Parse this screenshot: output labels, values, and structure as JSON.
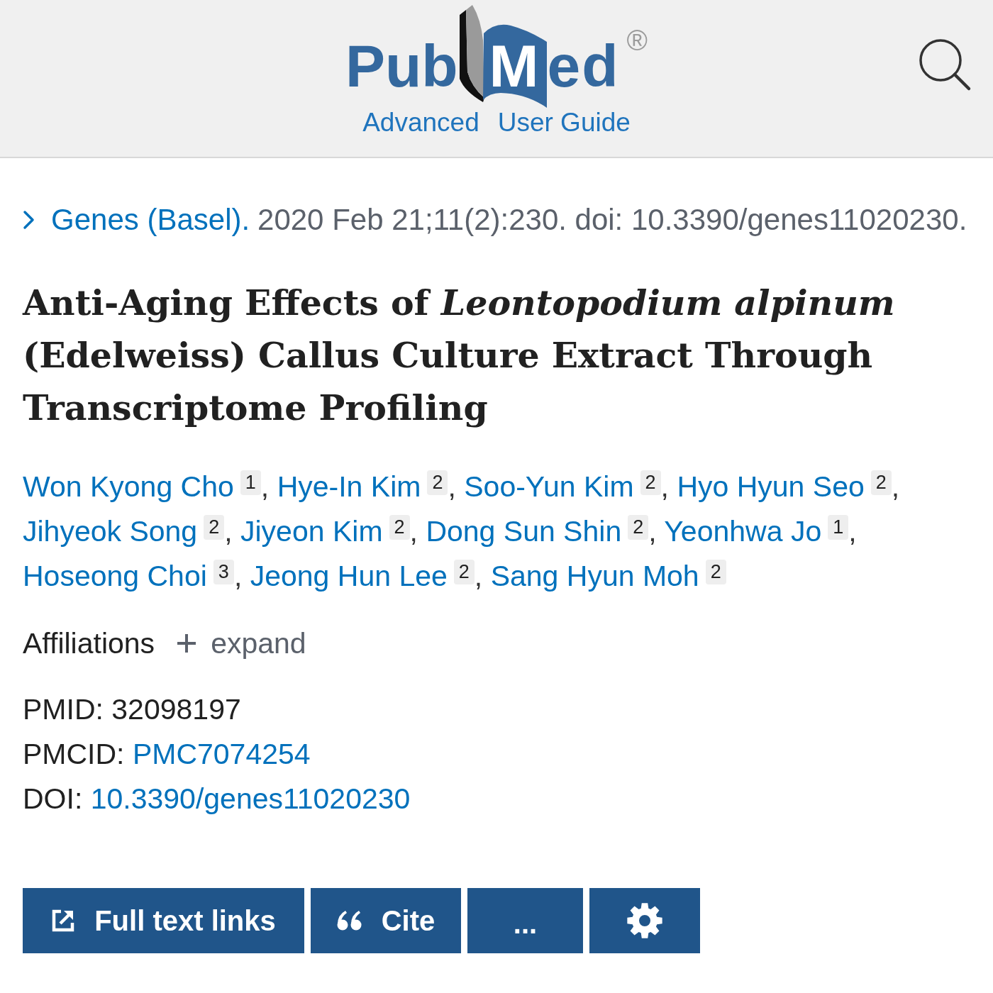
{
  "header": {
    "logo": {
      "left": "Pub",
      "right": "Med",
      "mark": "®"
    },
    "links": [
      "Advanced",
      "User Guide"
    ]
  },
  "citation": {
    "expanded": false,
    "journal": "Genes (Basel).",
    "details": "2020 Feb 21;11(2):230. doi: 10.3390/genes11020230."
  },
  "title": "Anti-Aging Effects of *Leontopodium alpinum* (Edelweiss) Callus Culture Extract Through Transcriptome Profiling",
  "authors": [
    {
      "name": "Won Kyong Cho",
      "affiliation": "1",
      "separator": ","
    },
    {
      "name": "Hye-In Kim",
      "affiliation": "2",
      "separator": ","
    },
    {
      "name": "Soo-Yun Kim",
      "affiliation": "2",
      "separator": ","
    },
    {
      "name": "Hyo Hyun Seo",
      "affiliation": "2",
      "separator": ","
    },
    {
      "name": "Jihyeok Song",
      "affiliation": "2",
      "separator": ","
    },
    {
      "name": "Jiyeon Kim",
      "affiliation": "2",
      "separator": ","
    },
    {
      "name": "Dong Sun Shin",
      "affiliation": "2",
      "separator": ","
    },
    {
      "name": "Yeonhwa Jo",
      "affiliation": "1",
      "separator": ","
    },
    {
      "name": "Hoseong Choi",
      "affiliation": "3",
      "separator": ","
    },
    {
      "name": "Jeong Hun Lee",
      "affiliation": "2",
      "separator": ","
    },
    {
      "name": "Sang Hyun Moh",
      "affiliation": "2"
    }
  ],
  "affiliations": {
    "label": "Affiliations",
    "expanded": false,
    "toggle": "expand"
  },
  "identifiers": [
    {
      "label": "PMID:",
      "value": "32098197",
      "kind": "text"
    },
    {
      "label": "PMCID:",
      "value": "PMC7074254",
      "kind": "link"
    },
    {
      "label": "DOI:",
      "value": "10.3390/genes11020230",
      "kind": "link"
    }
  ],
  "actions": [
    {
      "kind": "full_text",
      "label": "Full text links"
    },
    {
      "kind": "cite",
      "label": "Cite"
    },
    {
      "kind": "more",
      "label": "..."
    },
    {
      "kind": "settings"
    }
  ]
}
